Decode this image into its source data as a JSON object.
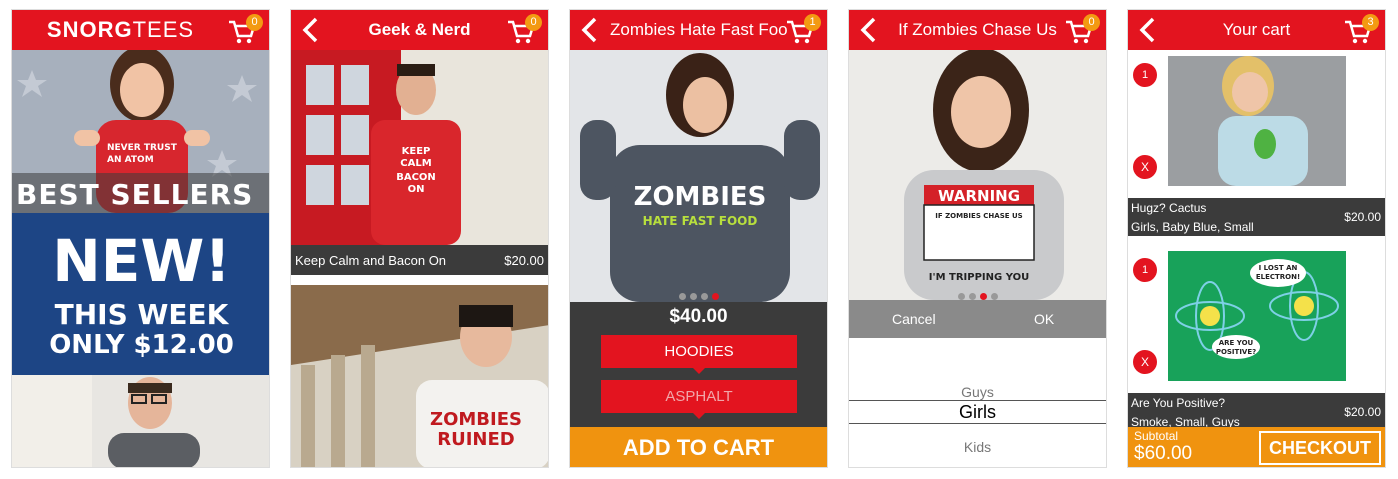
{
  "brand": {
    "red": "#e3141f",
    "orange": "#f0930f",
    "dark": "#3b3b3b",
    "navy": "#1d4585"
  },
  "screen1": {
    "logo_bold": "SNORG",
    "logo_light": "TEES",
    "cart_count": "0",
    "banner_best": "BEST  SELLERS",
    "promo_line1": "NEW!",
    "promo_line2": "THIS WEEK",
    "promo_line3": "ONLY $12.00"
  },
  "screen2": {
    "title": "Geek & Nerd",
    "cart_count": "0",
    "items": [
      {
        "name": "Keep Calm and Bacon On",
        "price": "$20.00"
      }
    ]
  },
  "screen3": {
    "title": "Zombies Hate Fast Food",
    "cart_count": "1",
    "price": "$40.00",
    "style_option": "HOODIES",
    "color_option": "ASPHALT",
    "add_label": "ADD TO CART",
    "carousel_dots": 4,
    "active_dot": 3
  },
  "screen4": {
    "title": "If Zombies Chase Us",
    "cart_count": "0",
    "cancel_label": "Cancel",
    "ok_label": "OK",
    "options": [
      "Guys",
      "Girls",
      "Kids"
    ],
    "selected": "Girls",
    "carousel_dots": 4,
    "active_dot": 2
  },
  "screen5": {
    "title": "Your cart",
    "cart_count": "3",
    "items": [
      {
        "qty": "1",
        "name": "Hugz? Cactus",
        "detail": "Girls, Baby Blue, Small",
        "price": "$20.00"
      },
      {
        "qty": "1",
        "name": "Are You Positive?",
        "detail": "Smoke, Small, Guys",
        "price": "$20.00"
      }
    ],
    "remove_label": "X",
    "subtotal_label": "Subtotal",
    "subtotal_value": "$60.00",
    "checkout_label": "CHECKOUT"
  }
}
